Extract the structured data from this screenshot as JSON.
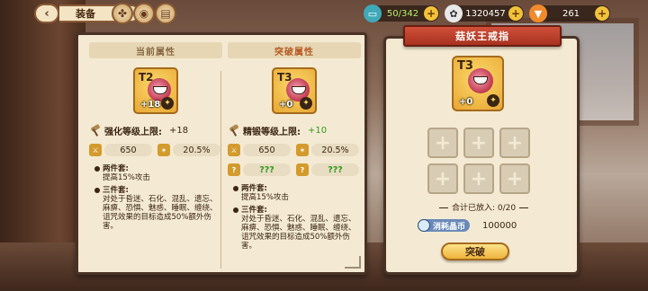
{
  "topbar": {
    "back_icon": "chevron-left-icon",
    "title": "装备",
    "energy": "50/342",
    "coins": "1320457",
    "carrots": "261"
  },
  "left_card": {
    "current_header": "当前属性",
    "breakthrough_header": "突破属性",
    "current": {
      "tier": "T2",
      "plus": "+18",
      "limit_label": "强化等级上限:",
      "limit_value": "+18",
      "attack": "650",
      "rate": "20.5%",
      "two_piece_title": "两件套:",
      "two_piece_text": "提高15%攻击",
      "three_piece_title": "三件套:",
      "three_piece_text": "对处于昏迷、石化、混乱、遗忘、麻痹、恐惧、魅惑、睡眠、缠绕、诅咒效果的目标造成50%额外伤害。"
    },
    "breakthrough": {
      "tier": "T3",
      "plus": "+0",
      "limit_label": "精锻等级上限:",
      "limit_value": "+10",
      "attack": "650",
      "rate": "20.5%",
      "unknown_a": "???",
      "unknown_b": "???",
      "two_piece_title": "两件套:",
      "two_piece_text": "提高15%攻击",
      "three_piece_title": "三件套:",
      "three_piece_text": "对处于昏迷、石化、混乱、遗忘、麻痹、恐惧、魅惑、睡眠、缠绕、诅咒效果的目标造成50%额外伤害。"
    }
  },
  "right_card": {
    "title": "菇妖王戒指",
    "item_tier": "T3",
    "item_plus": "+0",
    "slot_symbol": "+",
    "slots": 6,
    "count_label": "合计已放入:",
    "count_value": "0/20",
    "cost_label": "消耗晶币",
    "cost_value": "100000",
    "button_label": "突破"
  },
  "colors": {
    "ribbon": "#c0432f",
    "accent_gold": "#eeb23c",
    "green": "#2f9a1c"
  }
}
